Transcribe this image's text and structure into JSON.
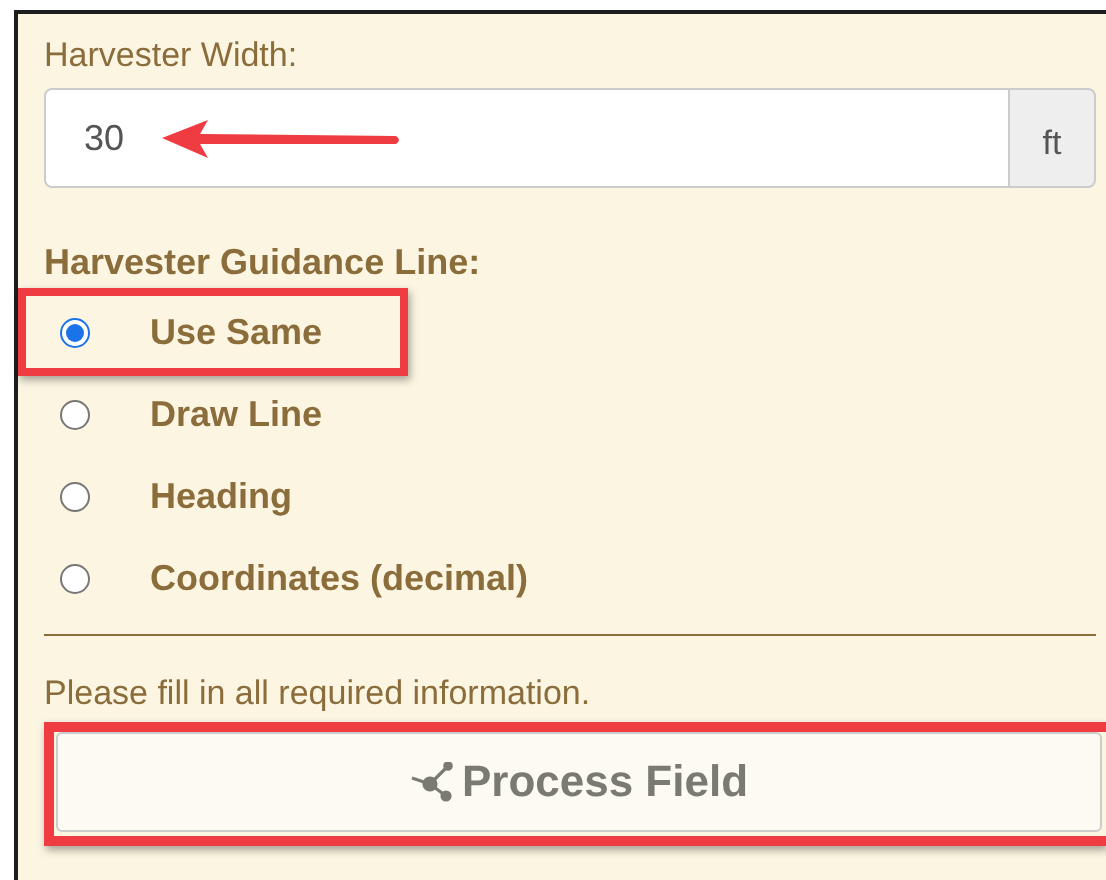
{
  "width_field": {
    "label": "Harvester Width:",
    "value": "30",
    "unit": "ft",
    "arrow": true
  },
  "guidance": {
    "heading": "Harvester Guidance Line:",
    "options": [
      {
        "label": "Use Same",
        "selected": true,
        "annotated": true
      },
      {
        "label": "Draw Line",
        "selected": false,
        "annotated": false
      },
      {
        "label": "Heading",
        "selected": false,
        "annotated": false
      },
      {
        "label": "Coordinates (decimal)",
        "selected": false,
        "annotated": false
      }
    ]
  },
  "message": "Please fill in all required information.",
  "button": {
    "label": "Process Field",
    "annotated": true
  }
}
